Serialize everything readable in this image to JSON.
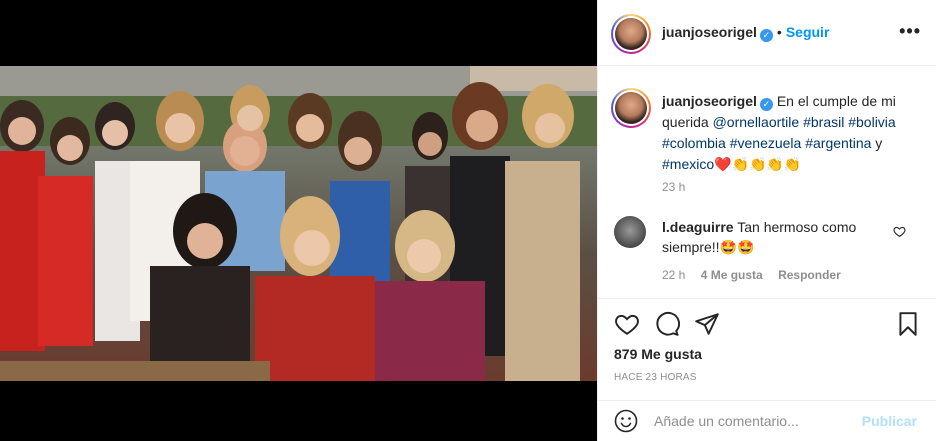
{
  "post": {
    "username": "juanjoseorigel",
    "follow_label": "Seguir",
    "more_label": "•••",
    "caption_text": "En el cumple de mi querida",
    "caption_mention": "@ornellaortile",
    "caption_tags": [
      "#brasil",
      "#bolivia",
      "#colombia",
      "#venezuela",
      "#argentina"
    ],
    "caption_and": "y",
    "caption_last_tag": "#mexico",
    "caption_emojis": "❤️👏👏👏👏",
    "time_ago": "23 h"
  },
  "comment": {
    "username": "l.deaguirre",
    "text": "Tan hermoso como siempre!!🤩🤩",
    "time": "22 h",
    "likes": "4 Me gusta",
    "reply_label": "Responder"
  },
  "actions": {
    "likes_count": "879 Me gusta",
    "posted": "HACE 23 HORAS"
  },
  "add_comment": {
    "placeholder": "Añade un comentario...",
    "publish_label": "Publicar"
  },
  "icons": {
    "like": "heart-icon",
    "comment": "comment-icon",
    "share": "share-icon",
    "save": "bookmark-icon",
    "emoji": "emoji-icon"
  },
  "colors": {
    "link": "#00376b",
    "follow": "#0095f6",
    "verified": "#3897f0",
    "publish_disabled": "#b2dffc"
  }
}
